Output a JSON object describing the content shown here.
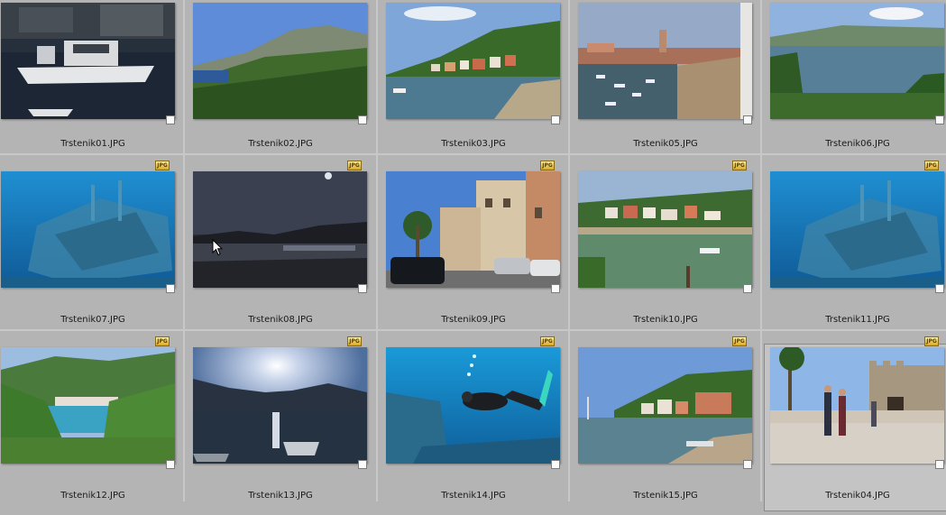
{
  "badge_text": "JPG",
  "colors": {
    "background": "#b4b4b4",
    "separator": "#c8c8c8",
    "selected_cell": "#c4c4c4"
  },
  "items": [
    {
      "filename": "Trstenik01.JPG",
      "scene": "harbor-boat",
      "badge": false,
      "selected": false
    },
    {
      "filename": "Trstenik02.JPG",
      "scene": "mountain-coast",
      "badge": false,
      "selected": false
    },
    {
      "filename": "Trstenik03.JPG",
      "scene": "village-bay",
      "badge": false,
      "selected": false
    },
    {
      "filename": "Trstenik05.JPG",
      "scene": "old-town-harbor",
      "badge": false,
      "selected": false
    },
    {
      "filename": "Trstenik06.JPG",
      "scene": "bay-landscape",
      "badge": false,
      "selected": false
    },
    {
      "filename": "Trstenik07.JPG",
      "scene": "underwater-wreck",
      "badge": true,
      "selected": false
    },
    {
      "filename": "Trstenik08.JPG",
      "scene": "dusk-sea",
      "badge": true,
      "selected": false
    },
    {
      "filename": "Trstenik09.JPG",
      "scene": "street-houses",
      "badge": true,
      "selected": false
    },
    {
      "filename": "Trstenik10.JPG",
      "scene": "waterfront-village",
      "badge": true,
      "selected": false
    },
    {
      "filename": "Trstenik11.JPG",
      "scene": "underwater-wreck",
      "badge": true,
      "selected": false
    },
    {
      "filename": "Trstenik12.JPG",
      "scene": "hillside-bay",
      "badge": true,
      "selected": false
    },
    {
      "filename": "Trstenik13.JPG",
      "scene": "sunset-boats",
      "badge": true,
      "selected": false
    },
    {
      "filename": "Trstenik14.JPG",
      "scene": "diver",
      "badge": true,
      "selected": false
    },
    {
      "filename": "Trstenik15.JPG",
      "scene": "harbor-village",
      "badge": true,
      "selected": false
    },
    {
      "filename": "Trstenik04.JPG",
      "scene": "fortress-couple",
      "badge": true,
      "selected": true
    }
  ]
}
